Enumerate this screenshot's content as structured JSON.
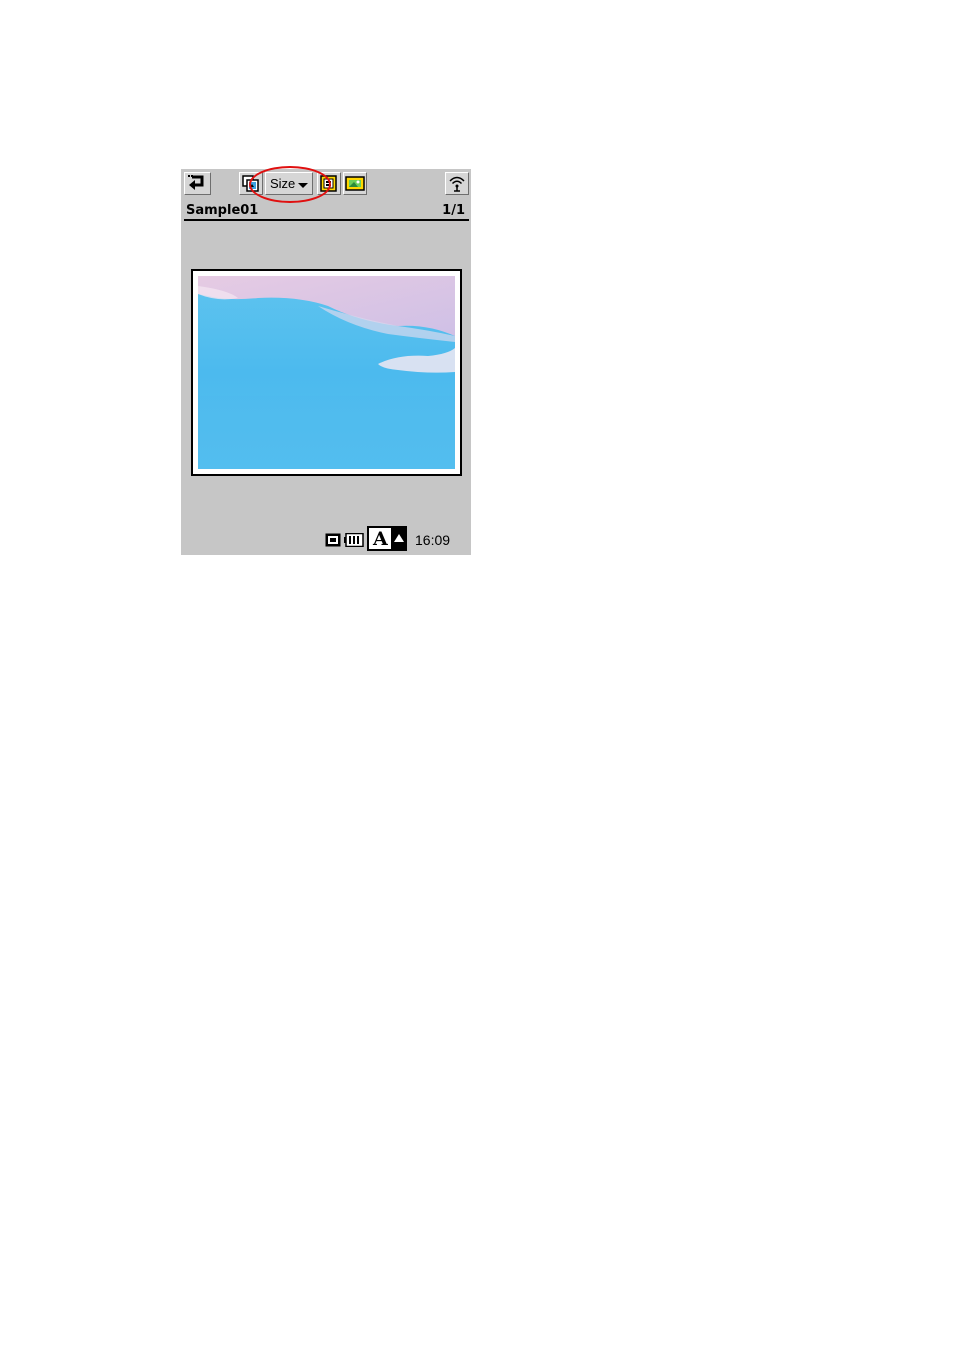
{
  "toolbar": {
    "back_icon": "return-arrow-icon",
    "select_icon": "select-images-icon",
    "size_label": "Size",
    "size_icon": "chevron-down-icon",
    "print_icon": "print-frame-icon",
    "image_icon": "picture-icon",
    "wireless_icon": "wireless-icon",
    "highlight_color": "#e01010"
  },
  "header": {
    "title": "Sample01",
    "page": "1/1"
  },
  "preview": {
    "image": "sea-landscape-photo"
  },
  "status": {
    "cf_icon": "cf-card-icon",
    "battery_icon": "battery-icon",
    "ime_icon": "input-mode-icon",
    "ime_label": "A",
    "time": "16:09"
  }
}
